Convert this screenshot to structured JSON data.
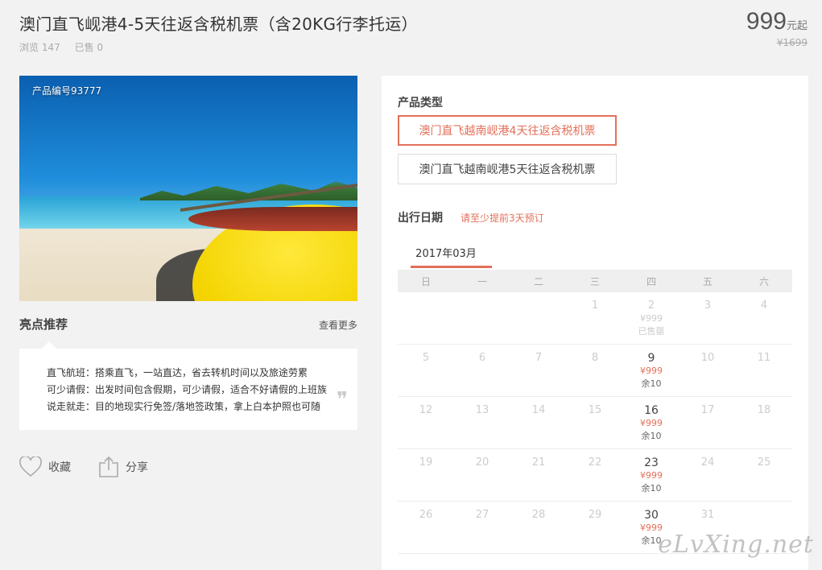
{
  "product": {
    "title": "澳门直飞岘港4-5天往返含税机票（含20KG行李托运）",
    "views": "浏览 147",
    "sold": "已售 0",
    "price": "999",
    "price_unit": "元起",
    "original_price": "¥1699",
    "image_tag": "产品编号93777"
  },
  "highlights": {
    "heading": "亮点推荐",
    "more": "查看更多",
    "lines": [
      "直飞航班：搭乘直飞，一站直达，省去转机时间以及旅途劳累",
      "可少请假：出发时间包含假期，可少请假，适合不好请假的上班族",
      "说走就走：目的地现实行免签/落地签政策，拿上白本护照也可随"
    ],
    "quote": "❞"
  },
  "actions": {
    "favorite": "收藏",
    "share": "分享"
  },
  "booking": {
    "type_label": "产品类型",
    "options": [
      {
        "label": "澳门直飞越南岘港4天往返含税机票",
        "selected": true
      },
      {
        "label": "澳门直飞越南岘港5天往返含税机票",
        "selected": false
      }
    ],
    "date_label": "出行日期",
    "date_hint": "请至少提前3天预订",
    "month": "2017年03月",
    "weekdays": [
      "日",
      "一",
      "二",
      "三",
      "四",
      "五",
      "六"
    ],
    "weeks": [
      [
        {
          "d": ""
        },
        {
          "d": ""
        },
        {
          "d": ""
        },
        {
          "d": "1"
        },
        {
          "d": "2",
          "p": "¥999",
          "s": "已售罄"
        },
        {
          "d": "3"
        },
        {
          "d": "4"
        }
      ],
      [
        {
          "d": "5"
        },
        {
          "d": "6"
        },
        {
          "d": "7"
        },
        {
          "d": "8"
        },
        {
          "d": "9",
          "p": "¥999",
          "s": "余10",
          "on": true
        },
        {
          "d": "10"
        },
        {
          "d": "11"
        }
      ],
      [
        {
          "d": "12"
        },
        {
          "d": "13"
        },
        {
          "d": "14"
        },
        {
          "d": "15"
        },
        {
          "d": "16",
          "p": "¥999",
          "s": "余10",
          "on": true
        },
        {
          "d": "17"
        },
        {
          "d": "18"
        }
      ],
      [
        {
          "d": "19"
        },
        {
          "d": "20"
        },
        {
          "d": "21"
        },
        {
          "d": "22"
        },
        {
          "d": "23",
          "p": "¥999",
          "s": "余10",
          "on": true
        },
        {
          "d": "24"
        },
        {
          "d": "25"
        }
      ],
      [
        {
          "d": "26"
        },
        {
          "d": "27"
        },
        {
          "d": "28"
        },
        {
          "d": "29"
        },
        {
          "d": "30",
          "p": "¥999",
          "s": "余10",
          "on": true
        },
        {
          "d": "31"
        },
        {
          "d": ""
        }
      ]
    ]
  },
  "watermark": "eLvXing.net",
  "colors": {
    "accent": "#e3705a",
    "background": "#f2f2f2"
  }
}
